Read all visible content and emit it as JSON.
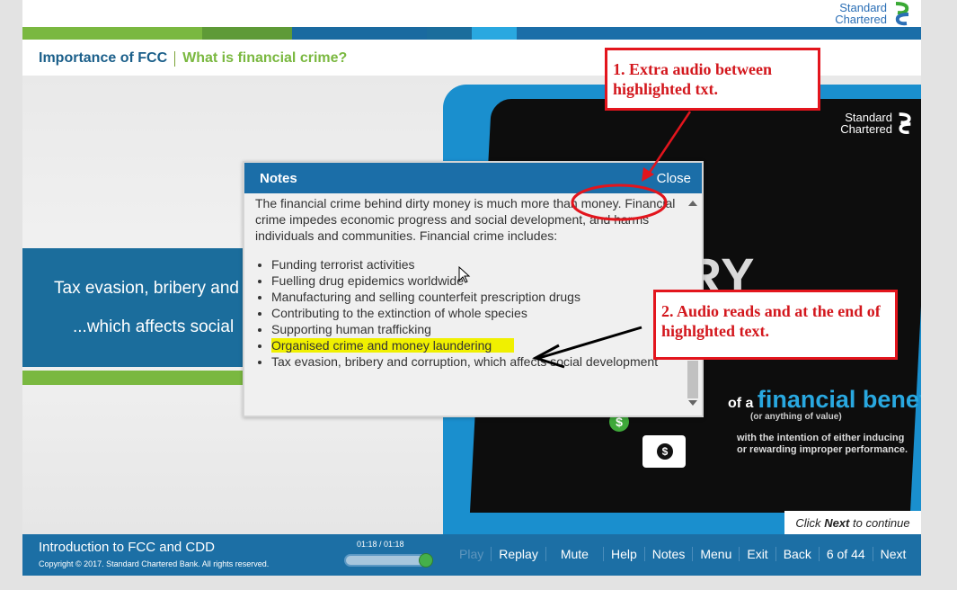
{
  "brand": {
    "line1": "Standard",
    "line2": "Chartered"
  },
  "breadcrumb": {
    "section": "Importance of FCC",
    "page": "What is financial crime?"
  },
  "banner": {
    "line1": "Tax evasion, bribery and",
    "line2": "...which affects social"
  },
  "slide": {
    "logo_line1": "Standard",
    "logo_line2": "Chartered",
    "headline": "RIBERY",
    "benefit_prefix": "of a ",
    "benefit_main": "financial benefit",
    "benefit_sub": "(or anything of value)",
    "benefit_desc1": "with the intention of either inducing",
    "benefit_desc2": "or rewarding improper performance.",
    "coin_symbol": "$",
    "bag_symbol": "$"
  },
  "click_next": {
    "prefix": "Click ",
    "bold": "Next",
    "suffix": " to continue"
  },
  "notes": {
    "title": "Notes",
    "close": "Close",
    "paragraph": "The financial crime behind dirty money is much more than money. Financial crime impedes economic progress and social development, and harms individuals and communities. Financial crime includes:",
    "items": [
      "Funding terrorist activities",
      "Fuelling drug epidemics worldwide",
      "Manufacturing and selling counterfeit prescription drugs",
      "Contributing to the extinction of whole species",
      "Supporting human trafficking",
      "Organised crime and money laundering",
      "Tax evasion, bribery and corruption, which affects social development"
    ],
    "highlighted_index": 5
  },
  "footer": {
    "course_title": "Introduction to FCC and CDD",
    "copyright": "Copyright © 2017. Standard Chartered Bank. All rights reserved.",
    "time": "01:18 / 01:18",
    "progress": 1.0,
    "nav": {
      "play": "Play",
      "replay": "Replay",
      "mute": "Mute",
      "help": "Help",
      "notes": "Notes",
      "menu": "Menu",
      "exit": "Exit",
      "back": "Back",
      "page": "6 of 44",
      "next": "Next"
    }
  },
  "annotations": {
    "callout1": "1. Extra audio between highlighted txt.",
    "callout2": "2. Audio reads and at the end of highlghted text."
  },
  "colors": {
    "brand_blue": "#1b6ea8",
    "brand_green": "#7ab840",
    "annotation_red": "#e3151d",
    "highlight": "#f0f000"
  }
}
